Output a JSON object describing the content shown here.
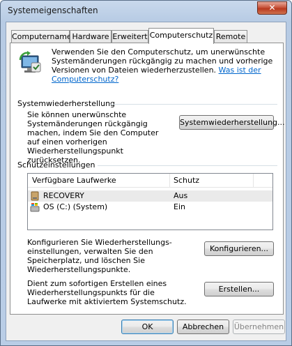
{
  "window": {
    "title": "Systemeigenschaften",
    "close_label": "✕"
  },
  "tabs": [
    {
      "label": "Computername",
      "active": false
    },
    {
      "label": "Hardware",
      "active": false
    },
    {
      "label": "Erweitert",
      "active": false
    },
    {
      "label": "Computerschutz",
      "active": true
    },
    {
      "label": "Remote",
      "active": false
    }
  ],
  "intro": {
    "icon": "system-protection-icon",
    "text": "Verwenden Sie den Computerschutz, um unerwünschte Systemänderungen rückgängig zu machen und vorherige Versionen von Dateien wiederherzustellen.",
    "link": "Was ist der Computerschutz?"
  },
  "restore": {
    "section_title": "Systemwiederherstellung",
    "description": "Sie können unerwünschte Systemänderungen rückgängig machen, indem Sie den Computer auf einen vorherigen Wiederherstellungspunkt zurücksetzen.",
    "button": "Systemwiederherstellung..."
  },
  "protection": {
    "section_title": "Schutzeinstellungen",
    "columns": [
      "Verfügbare Laufwerke",
      "Schutz"
    ],
    "drives": [
      {
        "name": "RECOVERY",
        "protection": "Aus",
        "icon": "drive-icon",
        "selected": true
      },
      {
        "name": "OS (C:) (System)",
        "protection": "Ein",
        "icon": "system-drive-icon",
        "selected": false
      }
    ],
    "configure_text": "Konfigurieren Sie Wiederherstellungs-einstellungen, verwalten Sie den Speicherplatz, und löschen Sie Wiederherstellungspunkte.",
    "configure_button": "Konfigurieren...",
    "create_text": "Dient zum sofortigen Erstellen eines Wiederherstellungspunkts für die Laufwerke mit aktiviertem Systemschutz.",
    "create_button": "Erstellen..."
  },
  "footer": {
    "ok": "OK",
    "cancel": "Abbrechen",
    "apply": "Übernehmen"
  }
}
